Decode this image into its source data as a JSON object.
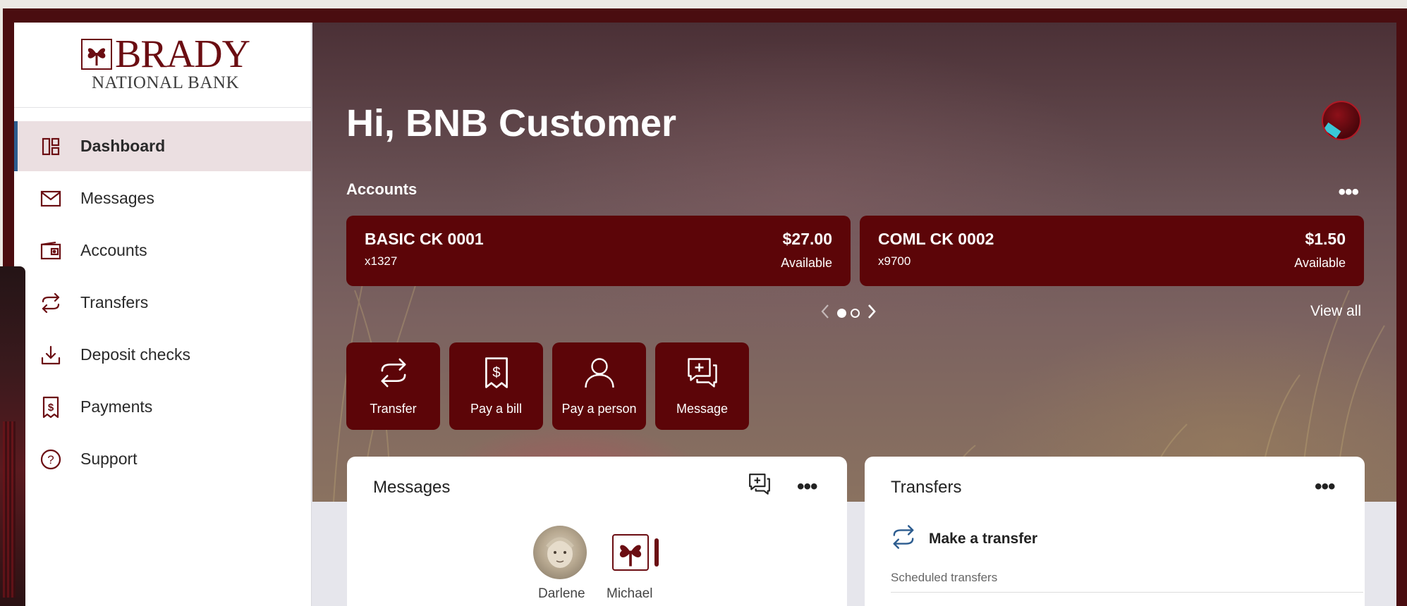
{
  "sidebar": {
    "logo_top": "BRADY",
    "logo_bottom": "NATIONAL BANK",
    "items": [
      {
        "label": "Dashboard",
        "icon": "dashboard-icon",
        "active": true
      },
      {
        "label": "Messages",
        "icon": "envelope-icon"
      },
      {
        "label": "Accounts",
        "icon": "wallet-icon"
      },
      {
        "label": "Transfers",
        "icon": "transfer-arrows-icon"
      },
      {
        "label": "Deposit checks",
        "icon": "download-icon"
      },
      {
        "label": "Payments",
        "icon": "receipt-dollar-icon"
      },
      {
        "label": "Support",
        "icon": "question-circle-icon"
      }
    ]
  },
  "header": {
    "greeting": "Hi, BNB Customer"
  },
  "accounts": {
    "title": "Accounts",
    "cards": [
      {
        "name": "BASIC CK 0001",
        "number": "x1327",
        "balance": "$27.00",
        "balance_label": "Available"
      },
      {
        "name": "COML CK 0002",
        "number": "x9700",
        "balance": "$1.50",
        "balance_label": "Available"
      }
    ],
    "view_all": "View all",
    "page_count": 2,
    "current_page": 1
  },
  "quick_actions": [
    {
      "label": "Transfer",
      "icon": "transfer-arrows-icon"
    },
    {
      "label": "Pay a bill",
      "icon": "receipt-dollar-icon"
    },
    {
      "label": "Pay a person",
      "icon": "person-icon"
    },
    {
      "label": "Message",
      "icon": "chat-plus-icon"
    }
  ],
  "messages_card": {
    "title": "Messages",
    "contacts": [
      {
        "name": "Darlene"
      },
      {
        "name": "Michael"
      }
    ]
  },
  "transfers_card": {
    "title": "Transfers",
    "make_transfer": "Make a transfer",
    "scheduled": "Scheduled transfers"
  },
  "colors": {
    "brand": "#5c0508",
    "accent_blue": "#2c5c8f",
    "active_nav_bg": "#ebdfe1"
  }
}
